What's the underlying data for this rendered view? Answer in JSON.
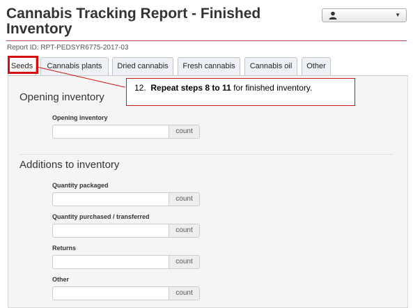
{
  "header": {
    "title": "Cannabis Tracking Report - Finished Inventory",
    "report_id": "Report ID: RPT-PEDSYR6775-2017-03",
    "user_menu_icon": "user-icon",
    "user_menu_caret": "chevron-down-icon"
  },
  "tabs": [
    {
      "label": "Seeds",
      "active": true
    },
    {
      "label": "Cannabis plants",
      "active": false
    },
    {
      "label": "Dried cannabis",
      "active": false
    },
    {
      "label": "Fresh cannabis",
      "active": false
    },
    {
      "label": "Cannabis oil",
      "active": false
    },
    {
      "label": "Other",
      "active": false
    }
  ],
  "callout": {
    "number": "12.",
    "bold_text": "Repeat steps  8 to 11",
    "rest_text": " for finished inventory.",
    "border_color": "#d50f0f"
  },
  "sections": {
    "opening": {
      "heading": "Opening inventory",
      "fields": [
        {
          "label": "Opening inventory",
          "value": "",
          "unit": "count"
        }
      ]
    },
    "additions": {
      "heading": "Additions to inventory",
      "fields": [
        {
          "label": "Quantity packaged",
          "value": "",
          "unit": "count"
        },
        {
          "label": "Quantity purchased / transferred",
          "value": "",
          "unit": "count"
        },
        {
          "label": "Returns",
          "value": "",
          "unit": "count"
        },
        {
          "label": "Other",
          "value": "",
          "unit": "count"
        }
      ]
    }
  },
  "colors": {
    "accent_rule": "#b9484c",
    "highlight": "#d50f0f",
    "panel_bg": "#f5f5f5"
  }
}
